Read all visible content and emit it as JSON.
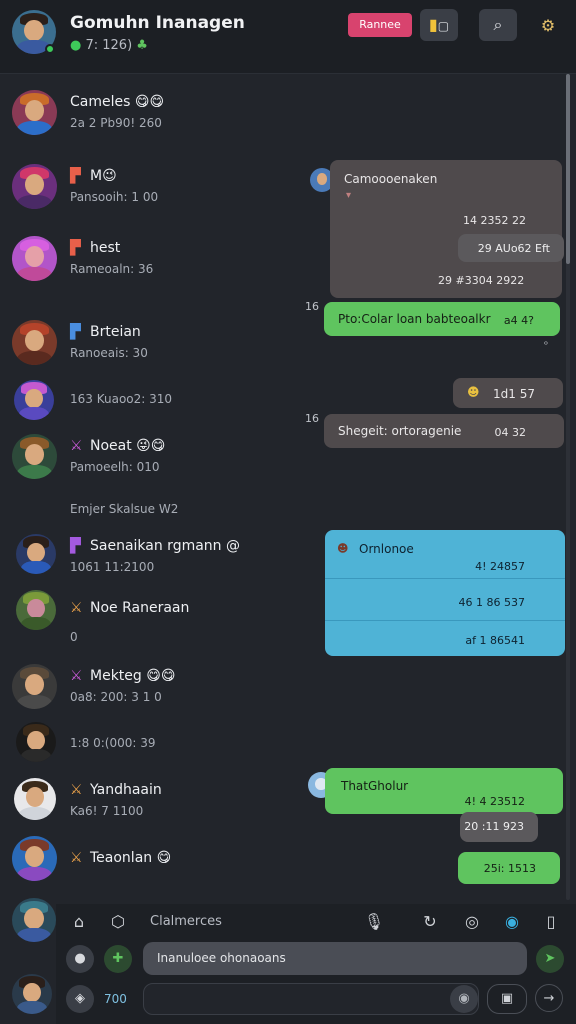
{
  "header": {
    "title": "Gomuhn Inanagen",
    "subtitle": "7: 126)",
    "badge": "Rannee",
    "btn1_icon": "chat-toggle-icon",
    "btn2_icon": "search-icon",
    "btn3_icon": "settings-icon"
  },
  "contacts": [
    {
      "name": "Cameles 😋😋",
      "meta": "2a 2 Pb90! 260"
    },
    {
      "name": "M😉",
      "meta": "Pansooih: 1 00"
    },
    {
      "name": "hest",
      "meta": "Rameoaln: 36"
    },
    {
      "name": "Brteian",
      "meta": "Ranoeais: 30"
    },
    {
      "name": "",
      "meta": "163 Kuaoo2: 310"
    },
    {
      "name": "Noeat 😜😋",
      "meta": "Pamoeelh: 010"
    },
    {
      "name": "Saenaikan rgmann @",
      "meta": "1061 11:2100"
    },
    {
      "name": "Noe Raneraan",
      "meta": "0"
    },
    {
      "name": "Mekteg 😋😋",
      "meta": "0a8: 200: 3 1 0"
    },
    {
      "name": "",
      "meta": "1:8 0:(000: 39"
    },
    {
      "name": "Yandhaain",
      "meta": "Ka6! 7 1100"
    },
    {
      "name": "Teaonlan 😋",
      "meta": ""
    }
  ],
  "section_label": "Emjer Skalsue W2",
  "messages": [
    {
      "text": "Camoooenaken",
      "time": "14 2352 22"
    },
    {
      "text": "",
      "time": "29 AUo62 Eft"
    },
    {
      "text": "",
      "time": "29 #3304 2922"
    },
    {
      "text": "Pto:Colar loan babteoalkr",
      "time": "a4 4?"
    },
    {
      "text": "",
      "time": "1d1 57"
    },
    {
      "text": "Shegeit: ortoragenie",
      "time": "04 32"
    },
    {
      "text": "Ornlonoe",
      "time": "4! 24857"
    },
    {
      "text": "",
      "time": "46 1 86 537"
    },
    {
      "text": "",
      "time": "af 1 86541"
    },
    {
      "text": "ThatGholur",
      "time": "4! 4 23512"
    },
    {
      "text": "",
      "time": "20 :11 923"
    },
    {
      "text": "",
      "time": "25i: 1513"
    }
  ],
  "side_numbers": [
    "16",
    "16"
  ],
  "footer": {
    "label": "Clalmerces",
    "message_placeholder": "Inanuloee ohonaoans",
    "counter": "700"
  }
}
